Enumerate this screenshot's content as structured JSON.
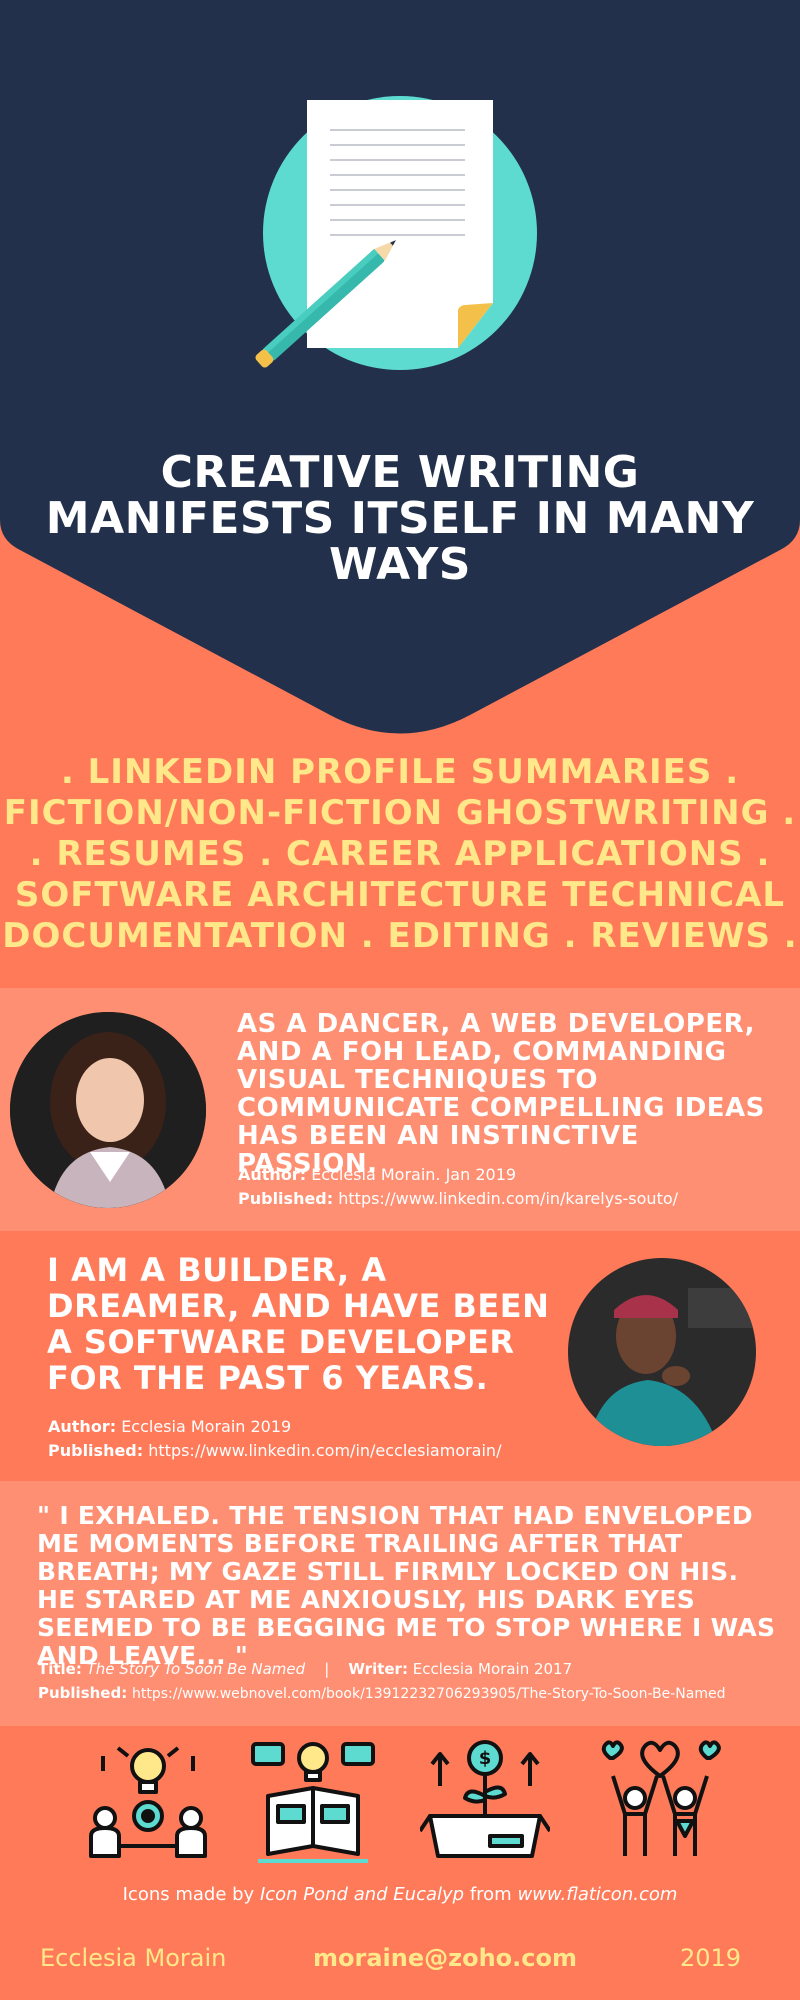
{
  "hero": {
    "title": "CREATIVE WRITING MANIFESTS ITSELF IN MANY WAYS"
  },
  "services": {
    "lines": [
      ". LINKEDIN PROFILE SUMMARIES .",
      "FICTION/NON-FICTION GHOSTWRITING .",
      ". RESUMES . CAREER APPLICATIONS .",
      "SOFTWARE ARCHITECTURE TECHNICAL",
      "DOCUMENTATION . EDITING . REVIEWS ."
    ]
  },
  "testimonials": [
    {
      "quote": "AS A DANCER, A WEB DEVELOPER, AND A FOH LEAD, COMMANDING VISUAL TECHNIQUES TO COMMUNICATE COMPELLING IDEAS HAS BEEN AN INSTINCTIVE PASSION.",
      "author_label": "Author:",
      "author_value": "Ecclesia Morain.  Jan 2019",
      "published_label": "Published:",
      "published_value": "https://www.linkedin.com/in/karelys-souto/"
    },
    {
      "quote": "I AM A BUILDER, A DREAMER, AND HAVE BEEN A SOFTWARE DEVELOPER FOR THE PAST 6 YEARS.",
      "author_label": "Author:",
      "author_value": "Ecclesia Morain 2019",
      "published_label": "Published:",
      "published_value": "https://www.linkedin.com/in/ecclesiamorain/"
    },
    {
      "quote": "\" I EXHALED. THE TENSION THAT HAD ENVELOPED ME MOMENTS BEFORE TRAILING AFTER THAT BREATH; MY GAZE STILL FIRMLY LOCKED ON HIS. HE STARED AT ME ANXIOUSLY, HIS DARK EYES SEEMED TO BE BEGGING ME TO STOP WHERE I WAS AND LEAVE... \"",
      "title_label": "Title:",
      "title_value": "The Story To Soon Be Named",
      "separator": "|",
      "writer_label": "Writer:",
      "writer_value": "Ecclesia Morain 2017",
      "published_label": "Published:",
      "published_value": "https://www.webnovel.com/book/13912232706293905/The-Story-To-Soon-Be-Named"
    }
  ],
  "icons": [
    "collaboration-icon",
    "book-ideas-icon",
    "growth-box-icon",
    "celebration-icon"
  ],
  "credit": {
    "prefix": "Icons made by",
    "authors": "Icon Pond and Eucalyp",
    "middle": "from",
    "site": "www.flaticon.com"
  },
  "footer": {
    "name": "Ecclesia Morain",
    "email": "moraine@zoho.com",
    "year": "2019"
  },
  "colors": {
    "navy": "#22304b",
    "coral": "#ff7a59",
    "coral_light": "#ff8f72",
    "yellow": "#ffe88a",
    "teal": "#5ddbd1"
  }
}
